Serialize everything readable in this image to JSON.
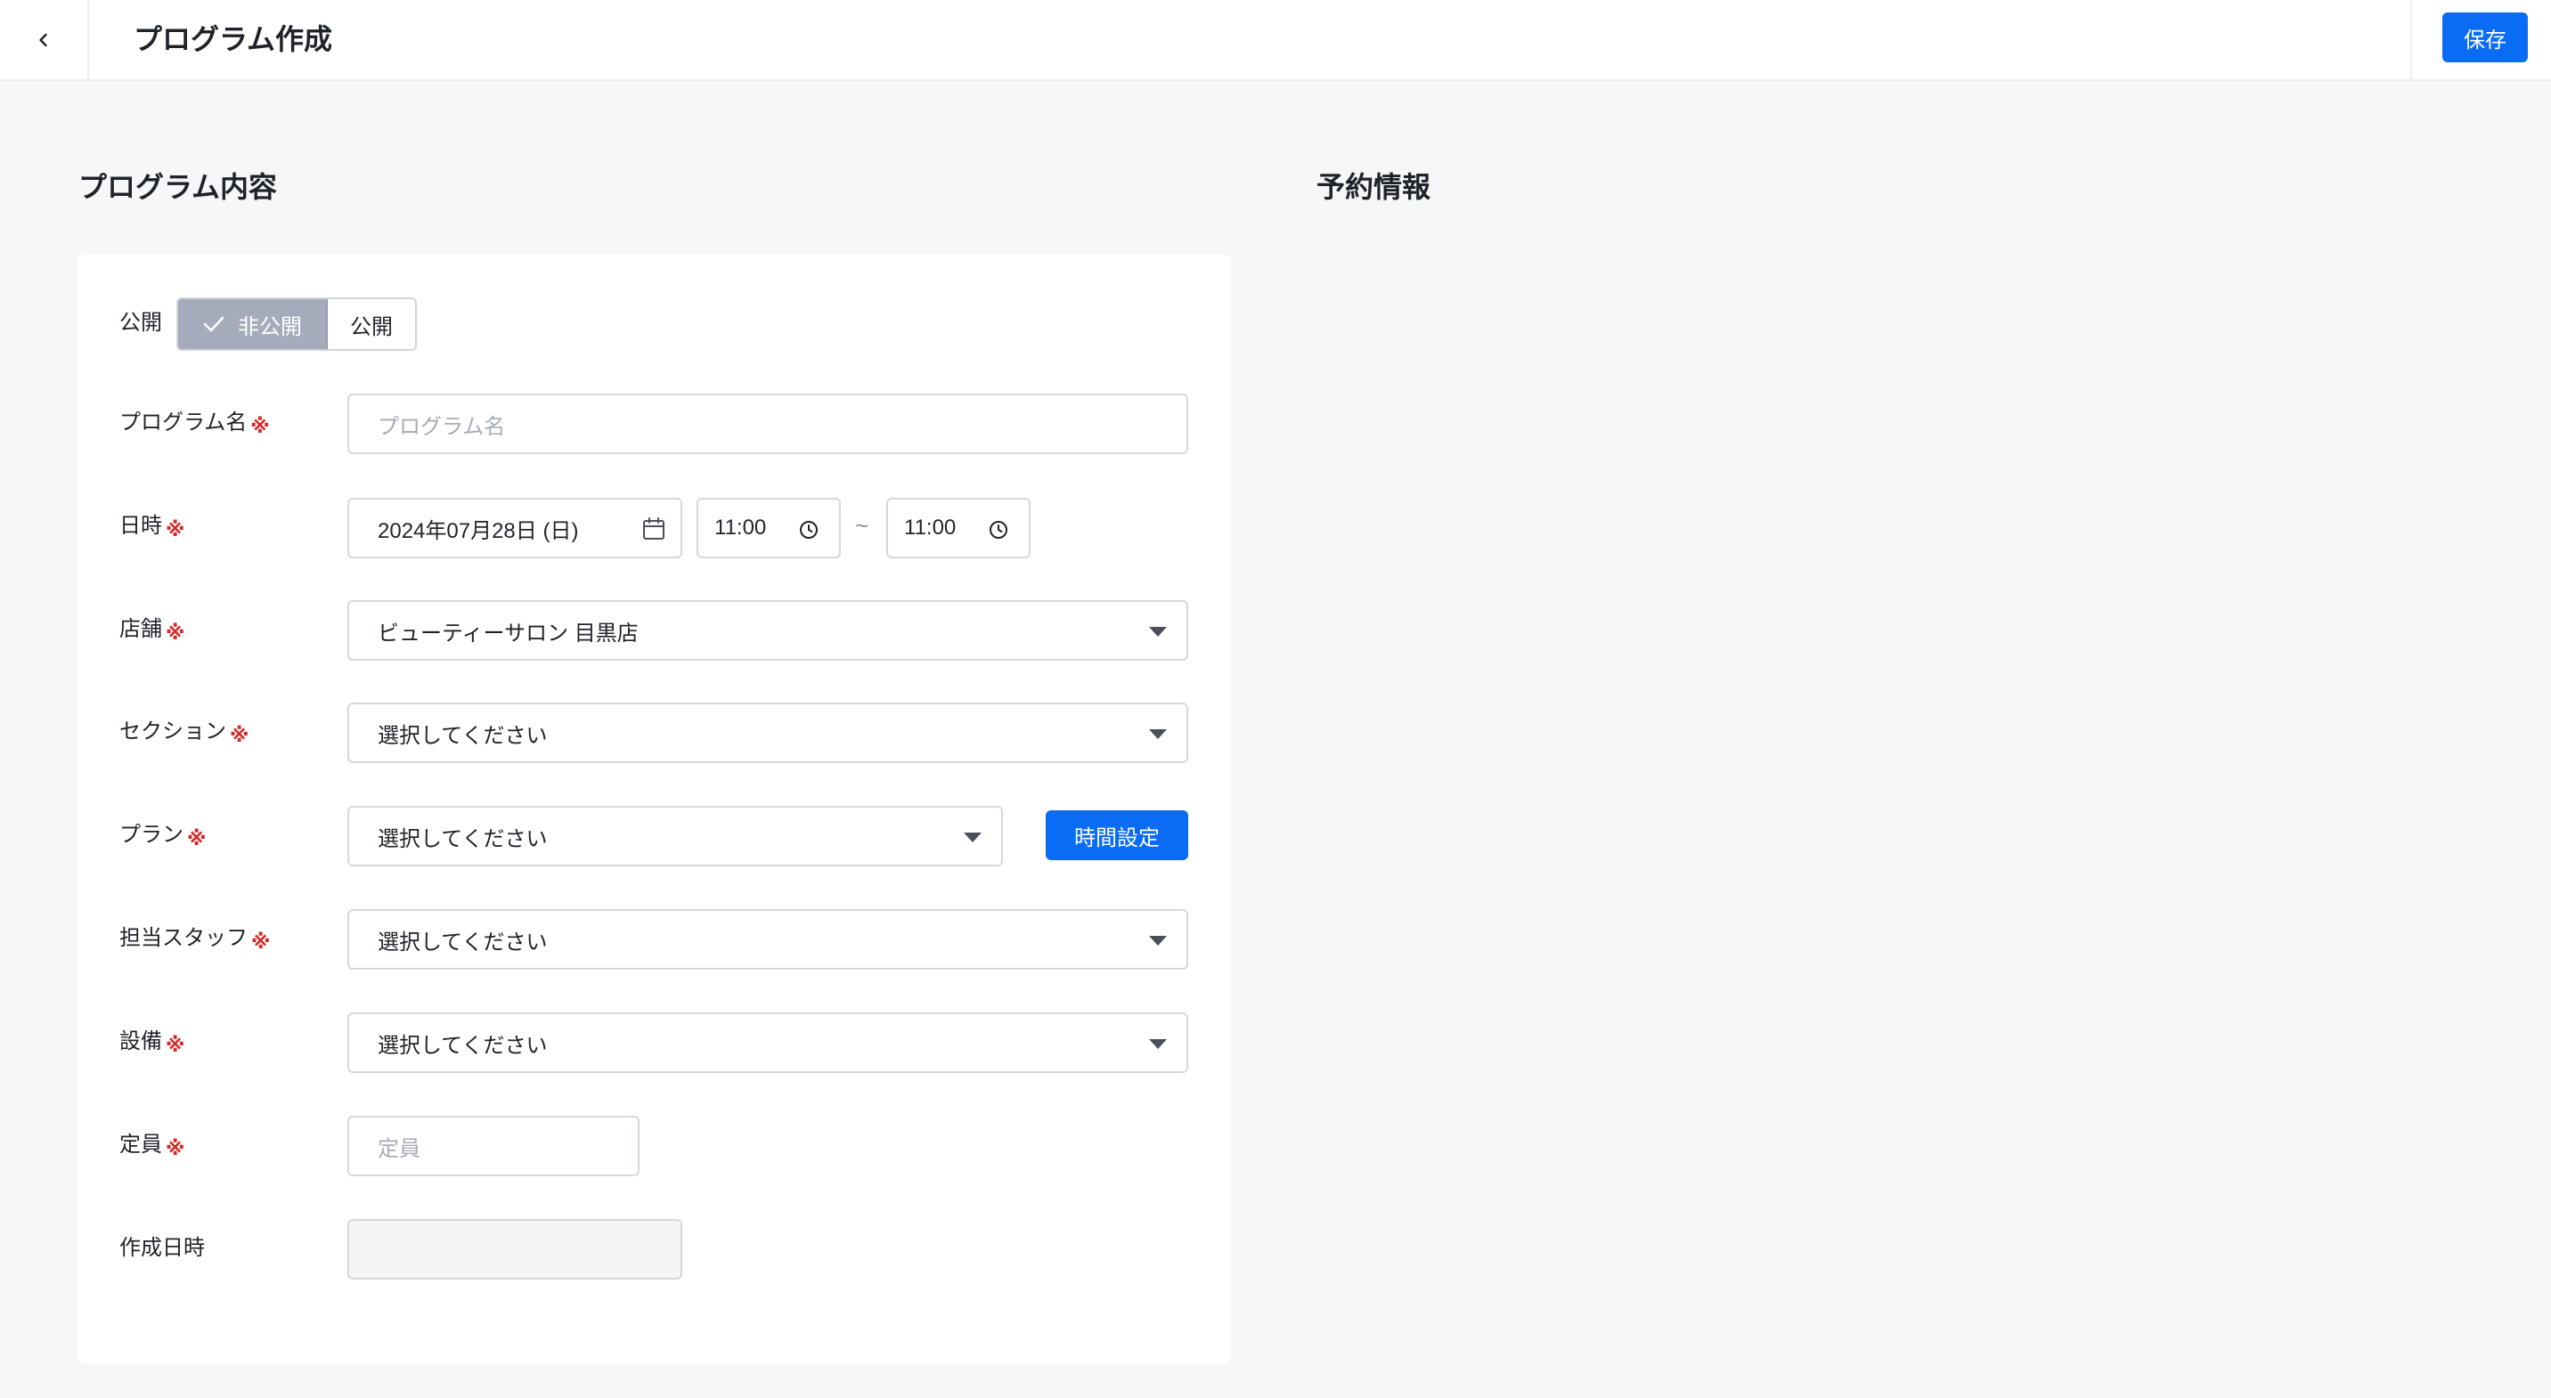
{
  "header": {
    "title": "プログラム作成",
    "save_label": "保存"
  },
  "sections": {
    "program_title": "プログラム内容",
    "reservation_title": "予約情報"
  },
  "form": {
    "visibility": {
      "label": "公開",
      "options": [
        "非公開",
        "公開"
      ],
      "selected": "非公開"
    },
    "program_name": {
      "label": "プログラム名",
      "placeholder": "プログラム名",
      "value": ""
    },
    "datetime": {
      "label": "日時",
      "date": "2024年07月28日 (日)",
      "start_time": "11:00",
      "separator": "~",
      "end_time": "11:00"
    },
    "store": {
      "label": "店舗",
      "value": "ビューティーサロン 目黒店"
    },
    "section": {
      "label": "セクション",
      "value": "選択してください"
    },
    "plan": {
      "label": "プラン",
      "value": "選択してください",
      "time_button": "時間設定"
    },
    "staff": {
      "label": "担当スタッフ",
      "value": "選択してください"
    },
    "equipment": {
      "label": "設備",
      "value": "選択してください"
    },
    "capacity": {
      "label": "定員",
      "placeholder": "定員",
      "value": ""
    },
    "created_at": {
      "label": "作成日時",
      "value": ""
    },
    "required_mark": "※"
  },
  "colors": {
    "primary": "#0a6cf5",
    "required": "#d42a2a",
    "segment_selected": "#a5abbb",
    "background": "#f6f7f9"
  }
}
